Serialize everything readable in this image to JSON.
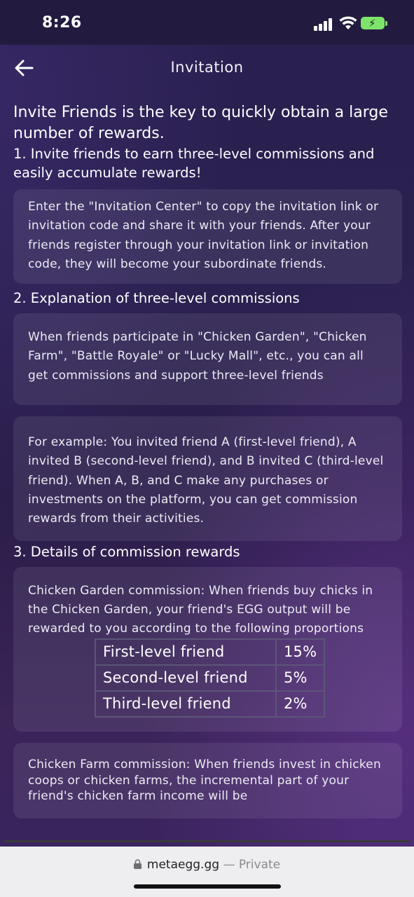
{
  "status_bar": {
    "time": "8:26"
  },
  "header": {
    "title": "Invitation"
  },
  "intro": "Invite Friends is the key to quickly obtain a large number of rewards.",
  "sections": {
    "s1": {
      "heading": "1. Invite friends to earn three-level commissions and easily accumulate rewards!",
      "card": "Enter the \"Invitation Center\" to copy the invitation link or invitation code and share it with your friends. After your friends register through your invitation link or invitation code, they will become your subordinate friends."
    },
    "s2": {
      "heading": "2. Explanation of three-level commissions",
      "card1": "When friends participate in \"Chicken Garden\", \"Chicken Farm\", \"Battle Royale\" or \"Lucky Mall\", etc., you can all get commissions and support three-level friends",
      "card2": "For example: You invited friend A (first-level friend), A invited B (second-level friend), and B invited C (third-level friend). When A, B, and C make any purchases or investments on the platform, you can get commission rewards from their activities."
    },
    "s3": {
      "heading": "3. Details of commission rewards",
      "garden_text": "Chicken Garden commission: When friends buy chicks in the Chicken Garden, your friend's EGG output will be rewarded to you according to the following proportions",
      "garden_table": [
        {
          "level": "First-level friend",
          "percent": "15%"
        },
        {
          "level": "Second-level friend",
          "percent": "5%"
        },
        {
          "level": "Third-level friend",
          "percent": "2%"
        }
      ],
      "farm_text": "Chicken Farm commission: When friends invest in chicken coops or chicken farms, the incremental part of your friend's chicken farm income will be"
    }
  },
  "browser": {
    "domain": "metaegg.gg",
    "mode": "— Private"
  },
  "colors": {
    "background": "#2a2050",
    "card": "#3b3560",
    "battery": "#7ee36a"
  }
}
